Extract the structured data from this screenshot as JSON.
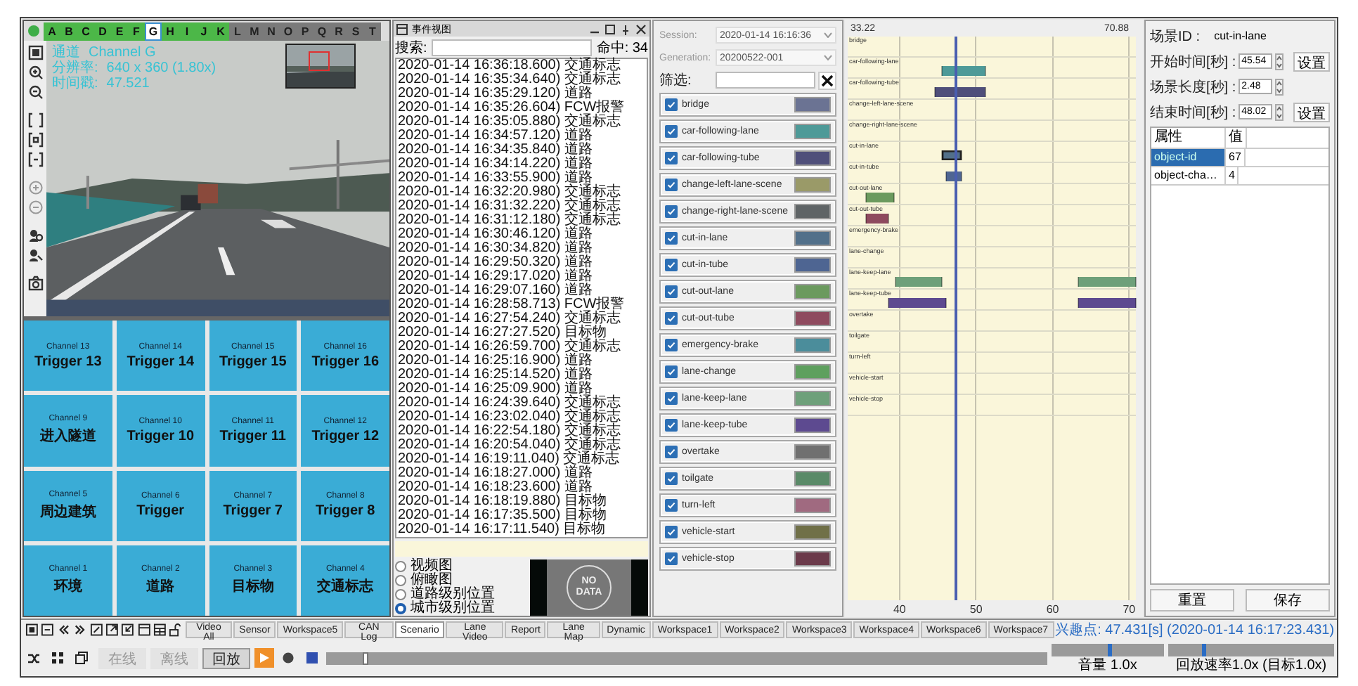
{
  "video_panel": {
    "channel_tabs": [
      {
        "label": "A",
        "kind": "available",
        "selected": false
      },
      {
        "label": "B",
        "kind": "available",
        "selected": false
      },
      {
        "label": "C",
        "kind": "available",
        "selected": false
      },
      {
        "label": "D",
        "kind": "available",
        "selected": false
      },
      {
        "label": "E",
        "kind": "available",
        "selected": false
      },
      {
        "label": "F",
        "kind": "available",
        "selected": false
      },
      {
        "label": "G",
        "kind": "available",
        "selected": true
      },
      {
        "label": "H",
        "kind": "available",
        "selected": false
      },
      {
        "label": "I",
        "kind": "available",
        "selected": false
      },
      {
        "label": "J",
        "kind": "available",
        "selected": false
      },
      {
        "label": "K",
        "kind": "available",
        "selected": false
      },
      {
        "label": "L",
        "kind": "unavailable",
        "selected": false
      },
      {
        "label": "M",
        "kind": "unavailable",
        "selected": false
      },
      {
        "label": "N",
        "kind": "unavailable",
        "selected": false
      },
      {
        "label": "O",
        "kind": "unavailable",
        "selected": false
      },
      {
        "label": "P",
        "kind": "unavailable",
        "selected": false
      },
      {
        "label": "Q",
        "kind": "unavailable",
        "selected": false
      },
      {
        "label": "R",
        "kind": "unavailable",
        "selected": false
      },
      {
        "label": "S",
        "kind": "unavailable",
        "selected": false
      },
      {
        "label": "T",
        "kind": "unavailable",
        "selected": false
      }
    ],
    "overlay": [
      {
        "label": "通道",
        "value": "Channel G"
      },
      {
        "label": "分辨率:",
        "value": "640 x 360 (1.80x)"
      },
      {
        "label": "时间戳:",
        "value": "47.521"
      }
    ]
  },
  "channel_grid": [
    {
      "channel": "Channel 13",
      "label": "Trigger 13"
    },
    {
      "channel": "Channel 14",
      "label": "Trigger 14"
    },
    {
      "channel": "Channel 15",
      "label": "Trigger 15"
    },
    {
      "channel": "Channel 16",
      "label": "Trigger 16"
    },
    {
      "channel": "Channel 9",
      "label": "进入隧道"
    },
    {
      "channel": "Channel 10",
      "label": "Trigger 10"
    },
    {
      "channel": "Channel 11",
      "label": "Trigger 11"
    },
    {
      "channel": "Channel 12",
      "label": "Trigger 12"
    },
    {
      "channel": "Channel 5",
      "label": "周边建筑"
    },
    {
      "channel": "Channel 6",
      "label": "Trigger"
    },
    {
      "channel": "Channel 7",
      "label": "Trigger 7"
    },
    {
      "channel": "Channel 8",
      "label": "Trigger 8"
    },
    {
      "channel": "Channel 1",
      "label": "环境"
    },
    {
      "channel": "Channel 2",
      "label": "道路"
    },
    {
      "channel": "Channel 3",
      "label": "目标物"
    },
    {
      "channel": "Channel 4",
      "label": "交通标志"
    }
  ],
  "event_panel": {
    "title": "事件视图",
    "search_label": "搜索:",
    "hit_count": "命中: 34",
    "events": [
      "2020-01-14 16:36:18.600) 交通标志",
      "2020-01-14 16:35:34.640) 交通标志",
      "2020-01-14 16:35:29.120) 道路",
      "2020-01-14 16:35:26.604) FCW报警",
      "2020-01-14 16:35:05.880) 交通标志",
      "2020-01-14 16:34:57.120) 道路",
      "2020-01-14 16:34:35.840) 道路",
      "2020-01-14 16:34:14.220) 道路",
      "2020-01-14 16:33:55.900) 道路",
      "2020-01-14 16:32:20.980) 交通标志",
      "2020-01-14 16:31:32.220) 交通标志",
      "2020-01-14 16:31:12.180) 交通标志",
      "2020-01-14 16:30:46.120) 道路",
      "2020-01-14 16:30:34.820) 道路",
      "2020-01-14 16:29:50.320) 道路",
      "2020-01-14 16:29:17.020) 道路",
      "2020-01-14 16:29:07.160) 道路",
      "2020-01-14 16:28:58.713) FCW报警",
      "2020-01-14 16:27:54.240) 交通标志",
      "2020-01-14 16:27:27.520) 目标物",
      "2020-01-14 16:26:59.700) 交通标志",
      "2020-01-14 16:25:16.900) 道路",
      "2020-01-14 16:25:14.520) 道路",
      "2020-01-14 16:25:09.900) 道路",
      "2020-01-14 16:24:39.640) 交通标志",
      "2020-01-14 16:23:02.040) 交通标志",
      "2020-01-14 16:22:54.180) 交通标志",
      "2020-01-14 16:20:54.040) 交通标志",
      "2020-01-14 16:19:11.040) 交通标志",
      "2020-01-14 16:18:27.000) 道路",
      "2020-01-14 16:18:23.600) 道路",
      "2020-01-14 16:18:19.880) 目标物",
      "2020-01-14 16:17:35.500) 目标物",
      "2020-01-14 16:17:11.540) 目标物"
    ],
    "view_options": [
      {
        "label": "视频图",
        "selected": false
      },
      {
        "label": "俯瞰图",
        "selected": false
      },
      {
        "label": "道路级别位置",
        "selected": false
      },
      {
        "label": "城市级别位置",
        "selected": true
      }
    ],
    "preview_text": [
      "NO",
      "DATA"
    ]
  },
  "scenario_panel": {
    "session_label": "Session:",
    "session": "2020-01-14 16:16:36",
    "generation_label": "Generation:",
    "generation": "20200522-001",
    "filter_label": "筛选:",
    "scenarios": [
      {
        "name": "bridge",
        "checked": true,
        "color": "#6b7393"
      },
      {
        "name": "car-following-lane",
        "checked": true,
        "color": "#4e9a98"
      },
      {
        "name": "car-following-tube",
        "checked": true,
        "color": "#4f4f7a"
      },
      {
        "name": "change-left-lane-scene",
        "checked": true,
        "color": "#9a9a68"
      },
      {
        "name": "change-right-lane-scene",
        "checked": true,
        "color": "#5f6466"
      },
      {
        "name": "cut-in-lane",
        "checked": true,
        "color": "#52708a"
      },
      {
        "name": "cut-in-tube",
        "checked": true,
        "color": "#4e6592"
      },
      {
        "name": "cut-out-lane",
        "checked": true,
        "color": "#6b9a5e"
      },
      {
        "name": "cut-out-tube",
        "checked": true,
        "color": "#8e4a5e"
      },
      {
        "name": "emergency-brake",
        "checked": true,
        "color": "#4b8d9b"
      },
      {
        "name": "lane-change",
        "checked": true,
        "color": "#5ea05e"
      },
      {
        "name": "lane-keep-lane",
        "checked": true,
        "color": "#6ea07a"
      },
      {
        "name": "lane-keep-tube",
        "checked": true,
        "color": "#5d4a90"
      },
      {
        "name": "overtake",
        "checked": true,
        "color": "#707070"
      },
      {
        "name": "toilgate",
        "checked": true,
        "color": "#5a8a68"
      },
      {
        "name": "turn-left",
        "checked": true,
        "color": "#a06a80"
      },
      {
        "name": "vehicle-start",
        "checked": true,
        "color": "#707048"
      },
      {
        "name": "vehicle-stop",
        "checked": true,
        "color": "#6b3a4a"
      }
    ]
  },
  "timeline": {
    "range_start": "33.22",
    "range_end": "70.88",
    "rows": [
      {
        "label": "bridge"
      },
      {
        "label": "car-following-lane",
        "segments": [
          {
            "start": {
              "level": 0.3277
            },
            "end": {
              "level": 0.4774
            },
            "selected": false
          }
        ]
      },
      {
        "label": "car-following-tube",
        "segments": [
          {
            "start": {
              "level": 0.3022
            },
            "end": {
              "level": 0.4774
            },
            "selected": false
          }
        ]
      },
      {
        "label": "change-left-lane-scene"
      },
      {
        "label": "change-right-lane-scene"
      },
      {
        "label": "cut-in-lane",
        "segments": [
          {
            "start": {
              "level": 0.3272
            },
            "end": {
              "level": 0.393
            },
            "selected": true
          }
        ]
      },
      {
        "label": "cut-in-tube",
        "segments": [
          {
            "start": {
              "level": 0.3393
            },
            "end": {
              "level": 0.3951
            },
            "selected": false
          }
        ]
      },
      {
        "label": "cut-out-lane",
        "segments": [
          {
            "start": {
              "level": 0.0632
            },
            "end": {
              "level": 0.1614
            },
            "selected": false
          }
        ]
      },
      {
        "label": "cut-out-tube",
        "segments": [
          {
            "start": {
              "level": 0.0632
            },
            "end": {
              "level": 0.1402
            },
            "selected": false
          }
        ]
      },
      {
        "label": "emergency-brake"
      },
      {
        "label": "lane-change"
      },
      {
        "label": "lane-keep-lane",
        "segments": [
          {
            "start": {
              "level": 0.1641
            },
            "end": {
              "level": 0.3287
            },
            "selected": false
          },
          {
            "start": {
              "level": 0.8014
            },
            "end": {
              "level": 1.0
            },
            "selected": false
          }
        ]
      },
      {
        "label": "lane-keep-tube",
        "segments": [
          {
            "start": {
              "level": 0.1402
            },
            "end": {
              "level": 0.342
            },
            "selected": false
          },
          {
            "start": {
              "level": 0.8014
            },
            "end": {
              "level": 1.0
            },
            "selected": false
          }
        ]
      },
      {
        "label": "overtake"
      },
      {
        "label": "toilgate"
      },
      {
        "label": "turn-left"
      },
      {
        "label": "vehicle-start"
      },
      {
        "label": "vehicle-stop"
      }
    ],
    "ticks": [
      {
        "label": "40",
        "level": 0.18
      },
      {
        "label": "50",
        "level": 0.4456
      },
      {
        "label": "60",
        "level": 0.7111
      },
      {
        "label": "70",
        "level": 0.9766
      }
    ],
    "cursor": {
      "level": 0.3773
    }
  },
  "details": {
    "fields": [
      {
        "kind": "text",
        "label": "场景ID :",
        "value": "cut-in-lane"
      },
      {
        "kind": "spin",
        "label": "开始时间[秒] :",
        "value": "45.54",
        "button": "设置"
      },
      {
        "kind": "spin",
        "label": "场景长度[秒] :",
        "value": "2.48"
      },
      {
        "kind": "spin",
        "label": "结束时间[秒] :",
        "value": "48.02",
        "button": "设置"
      }
    ],
    "table": {
      "columns": [
        "属性",
        "值"
      ],
      "rows": [
        {
          "cells": [
            "object-id",
            "67"
          ],
          "selected": true
        },
        {
          "cells": [
            "object-cha…",
            "4"
          ],
          "selected": false
        }
      ]
    },
    "buttons": [
      "重置",
      "保存"
    ]
  },
  "bottom_bar": {
    "tabs": [
      {
        "label": "Video All",
        "selected": false
      },
      {
        "label": "Sensor",
        "selected": false
      },
      {
        "label": "Workspace5",
        "selected": false
      },
      {
        "label": "CAN Log",
        "selected": false
      },
      {
        "label": "Scenario",
        "selected": true
      },
      {
        "label": "Lane Video",
        "selected": false
      },
      {
        "label": "Report",
        "selected": false
      },
      {
        "label": "Lane Map",
        "selected": false
      },
      {
        "label": "Dynamic",
        "selected": false
      },
      {
        "label": "Workspace1",
        "selected": false
      },
      {
        "label": "Workspace2",
        "selected": false
      },
      {
        "label": "Workspace3",
        "selected": false
      },
      {
        "label": "Workspace4",
        "selected": false
      },
      {
        "label": "Workspace6",
        "selected": false
      },
      {
        "label": "Workspace7",
        "selected": false
      }
    ],
    "cursor_info": "兴趣点: 47.431[s] (2020-01-14 16:17:23.431)",
    "modes": [
      {
        "label": "在线",
        "selected": false
      },
      {
        "label": "离线",
        "selected": false
      },
      {
        "label": "回放",
        "selected": true
      }
    ],
    "playback": {
      "level": 0.05
    },
    "volume": {
      "label": "音量 1.0x",
      "level": 0.5
    },
    "speed": {
      "label": "回放速率1.0x (目标1.0x)",
      "level": 0.2
    }
  }
}
